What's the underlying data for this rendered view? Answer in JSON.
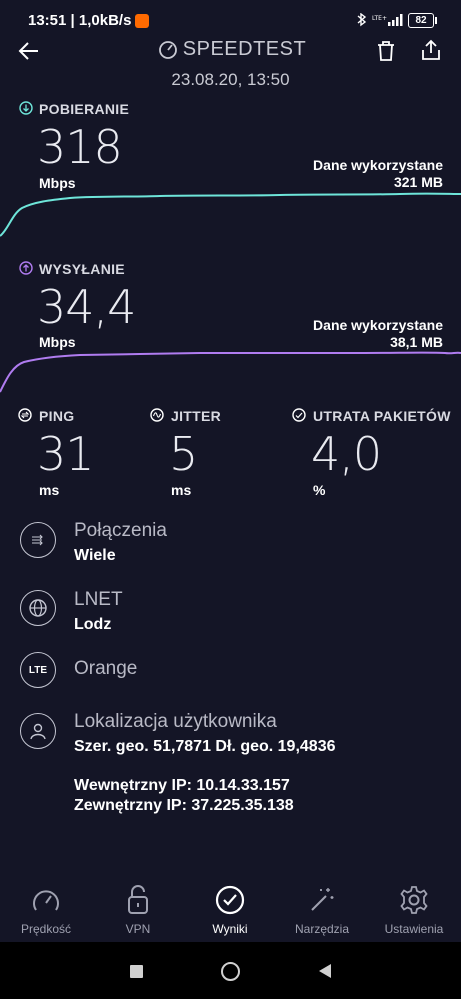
{
  "status_bar": {
    "time_speed": "13:51 | 1,0kB/s",
    "battery": "82"
  },
  "header": {
    "title": "SPEEDTEST",
    "date": "23.08.20, 13:50"
  },
  "download": {
    "label": "POBIERANIE",
    "value": "318",
    "unit": "Mbps",
    "data_label": "Dane wykorzystane",
    "data_value": "321 MB",
    "color": "#6ee5d9"
  },
  "upload": {
    "label": "WYSYŁANIE",
    "value": "34,4",
    "unit": "Mbps",
    "data_label": "Dane wykorzystane",
    "data_value": "38,1 MB",
    "color": "#b07cf0"
  },
  "metrics": {
    "ping": {
      "label": "PING",
      "value": "31",
      "unit": "ms"
    },
    "jitter": {
      "label": "JITTER",
      "value": "5",
      "unit": "ms"
    },
    "loss": {
      "label": "UTRATA PAKIETÓW",
      "value": "4,0",
      "unit": "%"
    }
  },
  "info": {
    "connections": {
      "title": "Połączenia",
      "sub": "Wiele"
    },
    "server": {
      "title": "LNET",
      "sub": "Lodz"
    },
    "carrier": {
      "badge": "LTE",
      "title": "Orange"
    },
    "location": {
      "title": "Lokalizacja użytkownika",
      "sub": "Szer. geo. 51,7871 Dł. geo. 19,4836"
    },
    "internal_ip": "Wewnętrzny IP: 10.14.33.157",
    "external_ip": "Zewnętrzny IP: 37.225.35.138"
  },
  "nav": [
    {
      "label": "Prędkość",
      "icon": "speedometer-icon",
      "active": false
    },
    {
      "label": "VPN",
      "icon": "lock-icon",
      "active": false
    },
    {
      "label": "Wyniki",
      "icon": "check-circle-icon",
      "active": true
    },
    {
      "label": "Narzędzia",
      "icon": "magic-wand-icon",
      "active": false
    },
    {
      "label": "Ustawienia",
      "icon": "gear-icon",
      "active": false
    }
  ]
}
